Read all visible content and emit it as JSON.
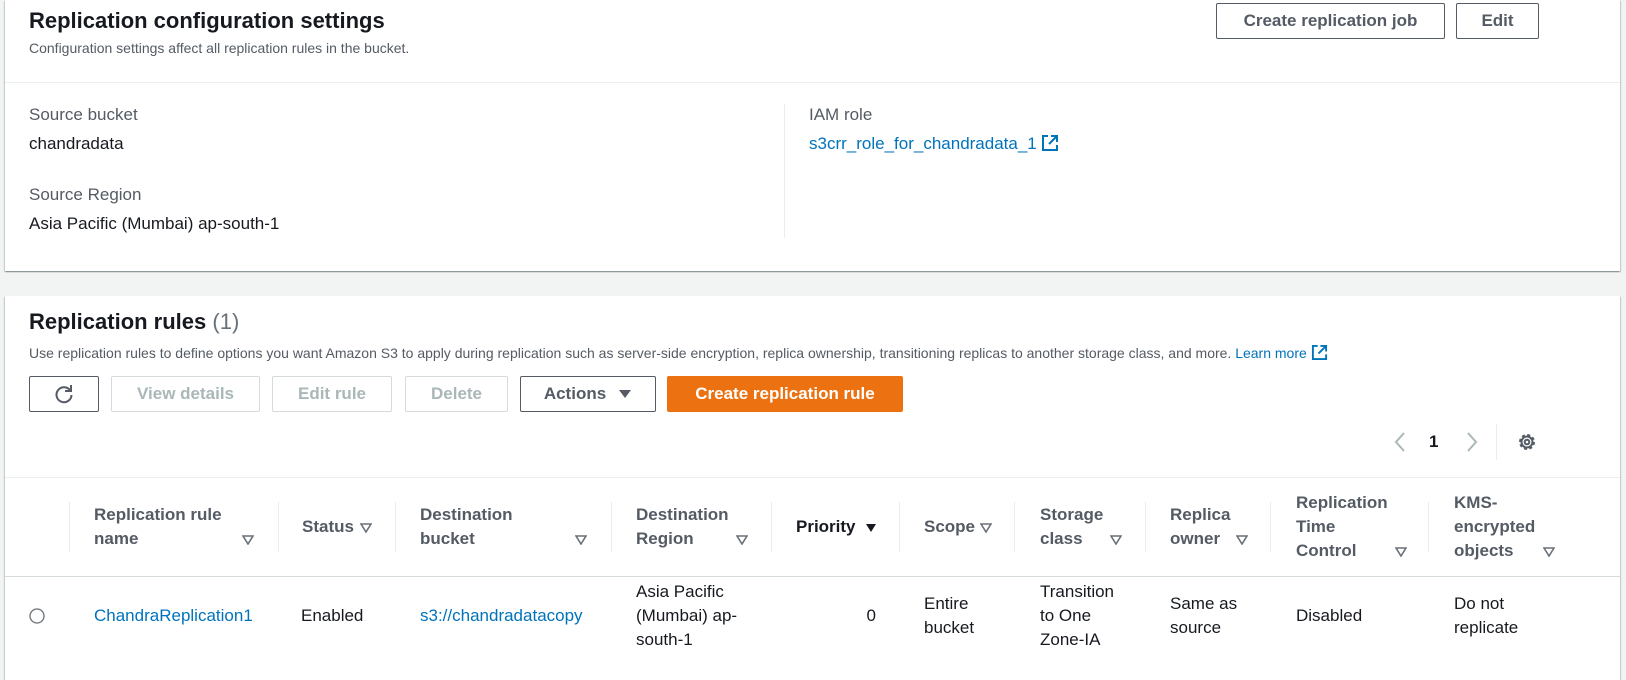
{
  "config": {
    "title": "Replication configuration settings",
    "description": "Configuration settings affect all replication rules in the bucket.",
    "create_job_label": "Create replication job",
    "edit_label": "Edit",
    "source_bucket_label": "Source bucket",
    "source_bucket_value": "chandradata",
    "source_region_label": "Source Region",
    "source_region_value": "Asia Pacific (Mumbai) ap-south-1",
    "iam_role_label": "IAM role",
    "iam_role_value": "s3crr_role_for_chandradata_1"
  },
  "rules": {
    "title": "Replication rules",
    "count": "(1)",
    "description": "Use replication rules to define options you want Amazon S3 to apply during replication such as server-side encryption, replica ownership, transitioning replicas to another storage class, and more.",
    "learn_more": "Learn more",
    "toolbar": {
      "view_details": "View details",
      "edit_rule": "Edit rule",
      "delete": "Delete",
      "actions": "Actions",
      "create_rule": "Create replication rule"
    },
    "pagination": {
      "current_page": "1"
    },
    "columns": {
      "name": [
        "Replication rule",
        "name"
      ],
      "status": [
        "Status"
      ],
      "dest_bucket": [
        "Destination",
        "bucket"
      ],
      "dest_region": [
        "Destination",
        "Region"
      ],
      "priority": [
        "Priority"
      ],
      "scope": [
        "Scope"
      ],
      "storage_class": [
        "Storage",
        "class"
      ],
      "replica_owner": [
        "Replica",
        "owner"
      ],
      "rtc": [
        "Replication",
        "Time",
        "Control"
      ],
      "kms": [
        "KMS-",
        "encrypted",
        "objects"
      ]
    },
    "row": {
      "name": "ChandraReplication1",
      "status": "Enabled",
      "dest_bucket": "s3://chandradatacopy",
      "dest_region": [
        "Asia Pacific",
        "(Mumbai) ap-",
        "south-1"
      ],
      "priority": "0",
      "scope": [
        "Entire",
        "bucket"
      ],
      "storage_class": [
        "Transition",
        "to One",
        "Zone-IA"
      ],
      "replica_owner": [
        "Same as",
        "source"
      ],
      "rtc": "Disabled",
      "kms": [
        "Do not",
        "replicate"
      ]
    }
  },
  "colors": {
    "primary": "#ec7211",
    "link": "#0073bb",
    "text": "#16191f",
    "muted": "#545b64",
    "disabled": "#aab7b8"
  }
}
